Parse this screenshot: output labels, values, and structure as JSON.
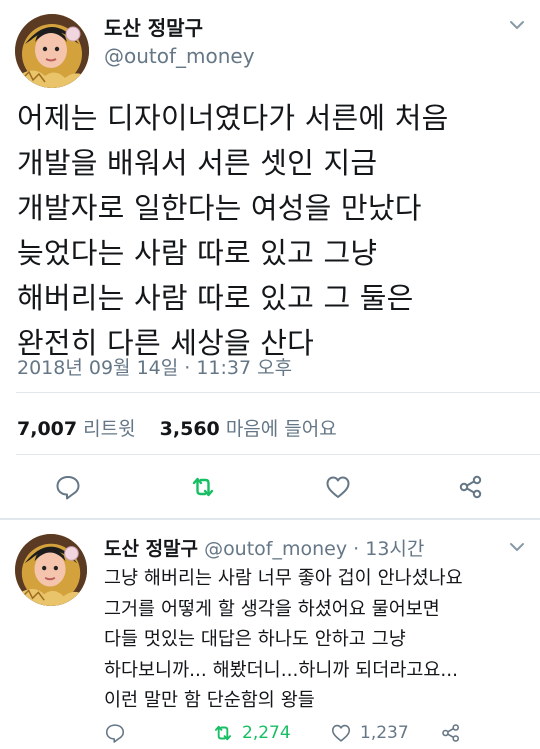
{
  "main_tweet": {
    "name": "도산 정말구",
    "handle": "@outof_money",
    "text_lines": [
      "어제는 디자이너였다가 서른에 처음",
      "개발을 배워서 서른 셋인 지금",
      "개발자로 일한다는 여성을 만났다",
      "늦었다는 사람 따로 있고 그냥",
      "해버리는 사람 따로 있고 그 둘은",
      "완전히 다른 세상을 산다"
    ],
    "timestamp": "2018년 09월 14일 · 11:37 오후",
    "retweet_count": "7,007",
    "retweet_label": "리트윗",
    "like_count": "3,560",
    "like_label": "마음에 들어요"
  },
  "reply_tweet": {
    "name": "도산 정말구",
    "handle": "@outof_money",
    "time": "· 13시간",
    "text_lines": [
      "그냥 해버리는 사람 너무 좋아 겁이 안나셨나요",
      "그거를 어떻게 할 생각을 하셨어요 물어보면",
      "다들 멋있는 대답은 하나도 안하고 그냥",
      "하다보니까... 해봤더니...하니까 되더라고요...",
      "이런 말만 함 단순함의 왕들"
    ],
    "retweet_count": "2,274",
    "like_count": "1,237"
  },
  "colors": {
    "text": "#14171a",
    "secondary": "#657786",
    "retweet_active": "#17bf63",
    "divider": "#e1e8ed"
  },
  "icons": [
    "reply-icon",
    "retweet-icon",
    "like-icon",
    "share-icon",
    "chevron-down-icon"
  ]
}
